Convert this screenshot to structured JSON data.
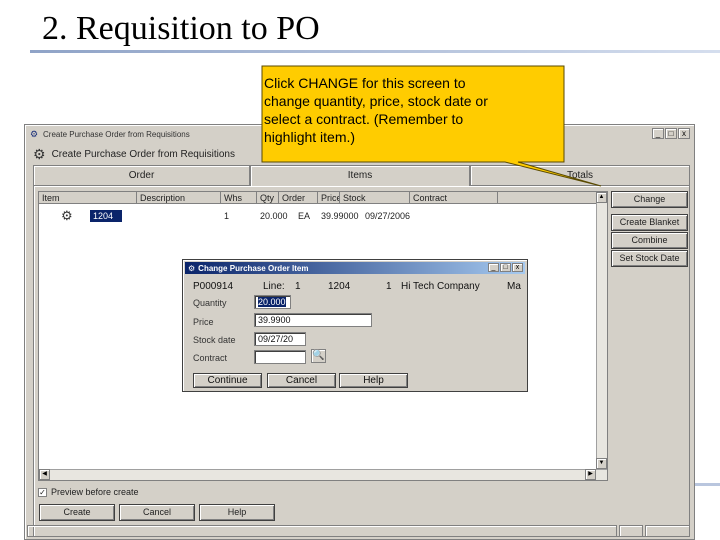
{
  "slide": {
    "title": "2. Requisition to PO"
  },
  "callout": {
    "lines": [
      "Click CHANGE for this screen to",
      "change quantity, price, stock date or",
      "select a contract. (Remember to",
      "highlight item.)"
    ],
    "fill_color": "#ffcc00"
  },
  "window": {
    "title": "Create Purchase Order from Requisitions",
    "header": "Create Purchase Order from Requisitions",
    "controls": [
      "_",
      "□",
      "x"
    ],
    "tabs": [
      {
        "label": "Order"
      },
      {
        "label": "Items",
        "active": true
      },
      {
        "label": "Totals"
      }
    ],
    "grid": {
      "columns": [
        "Item",
        "Description",
        "Whs",
        "Qty",
        "Order",
        "Price",
        "Stock",
        "Contract"
      ],
      "rows": [
        {
          "item": "1204",
          "description": "",
          "whs": "1",
          "qty": "20.000",
          "order": "EA",
          "price": "39.99000",
          "stock": "09/27/2006",
          "contract": ""
        }
      ]
    },
    "side_buttons": [
      "Change",
      "Create Blanket",
      "Combine",
      "Set Stock Date"
    ],
    "preview_label": "Preview before create",
    "preview_checked": true,
    "bottom_buttons": [
      "Create",
      "Cancel",
      "Help"
    ]
  },
  "dialog": {
    "title": "Change Purchase Order Item",
    "po_number": "P000914",
    "line_label": "Line:",
    "line_value": "1",
    "item": "1204",
    "vendor_id": "1",
    "vendor_name": "Hi Tech Company",
    "vendor_suffix": "Ma",
    "labels": {
      "quantity": "Quantity",
      "price": "Price",
      "stock_date": "Stock date",
      "contract": "Contract"
    },
    "values": {
      "quantity": "20.000",
      "price": "39.9900",
      "stock_date": "09/27/20",
      "contract": ""
    },
    "buttons": [
      "Continue",
      "Cancel",
      "Help"
    ]
  }
}
